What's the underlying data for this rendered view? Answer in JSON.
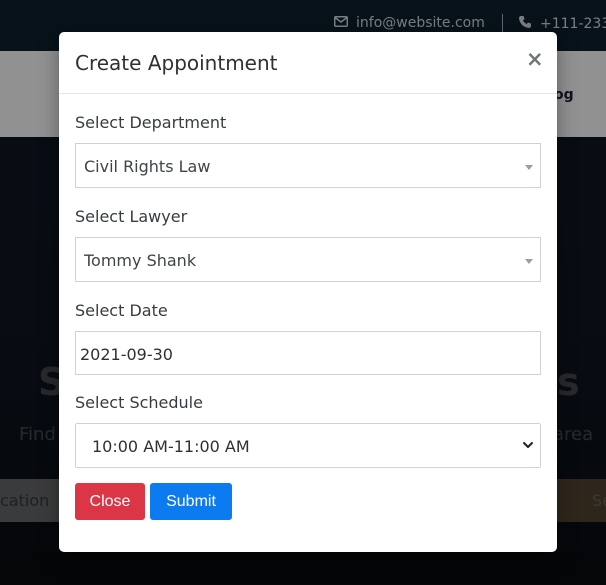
{
  "topbar": {
    "email": "info@website.com",
    "phone": "+111-233-"
  },
  "navbar": {
    "visible_link": "og"
  },
  "hero": {
    "heading_left": "S",
    "heading_right": "s",
    "subtitle_left": "Find",
    "subtitle_right": "area",
    "search_partial": "cation",
    "button_partial": "Se"
  },
  "modal": {
    "title": "Create Appointment",
    "close_glyph": "×",
    "department": {
      "label": "Select Department",
      "value": "Civil Rights Law"
    },
    "lawyer": {
      "label": "Select Lawyer",
      "value": "Tommy Shank"
    },
    "date": {
      "label": "Select Date",
      "value": "2021-09-30"
    },
    "schedule": {
      "label": "Select Schedule",
      "value": "10:00 AM-11:00 AM"
    },
    "buttons": {
      "close": "Close",
      "submit": "Submit"
    }
  },
  "colors": {
    "close_button": "#dc3545",
    "submit_button": "#0d7bf0",
    "topbar": "#0d1f2e"
  },
  "icons": {
    "email": "envelope-icon",
    "phone": "phone-icon"
  }
}
